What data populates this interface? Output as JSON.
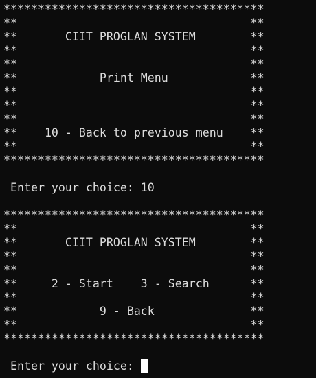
{
  "terminal": {
    "lines": [
      "**************************************",
      "**                                  **",
      "**       CIIT PROGLAN SYSTEM        **",
      "**                                  **",
      "**                                  **",
      "**            Print Menu            **",
      "**                                  **",
      "**                                  **",
      "**                                  **",
      "**    10 - Back to previous menu    **",
      "**                                  **",
      "**************************************",
      "",
      " Enter your choice: 10",
      "",
      "**************************************",
      "**                                  **",
      "**       CIIT PROGLAN SYSTEM        **",
      "**                                  **",
      "**                                  **",
      "**     2 - Start    3 - Search      **",
      "**                                  **",
      "**            9 - Back              **",
      "**                                  **",
      "**************************************",
      "",
      " Enter your choice: "
    ]
  },
  "colors": {
    "background": "#0c0c0c",
    "text": "#dcdcdc",
    "cursor": "#ffffff"
  }
}
